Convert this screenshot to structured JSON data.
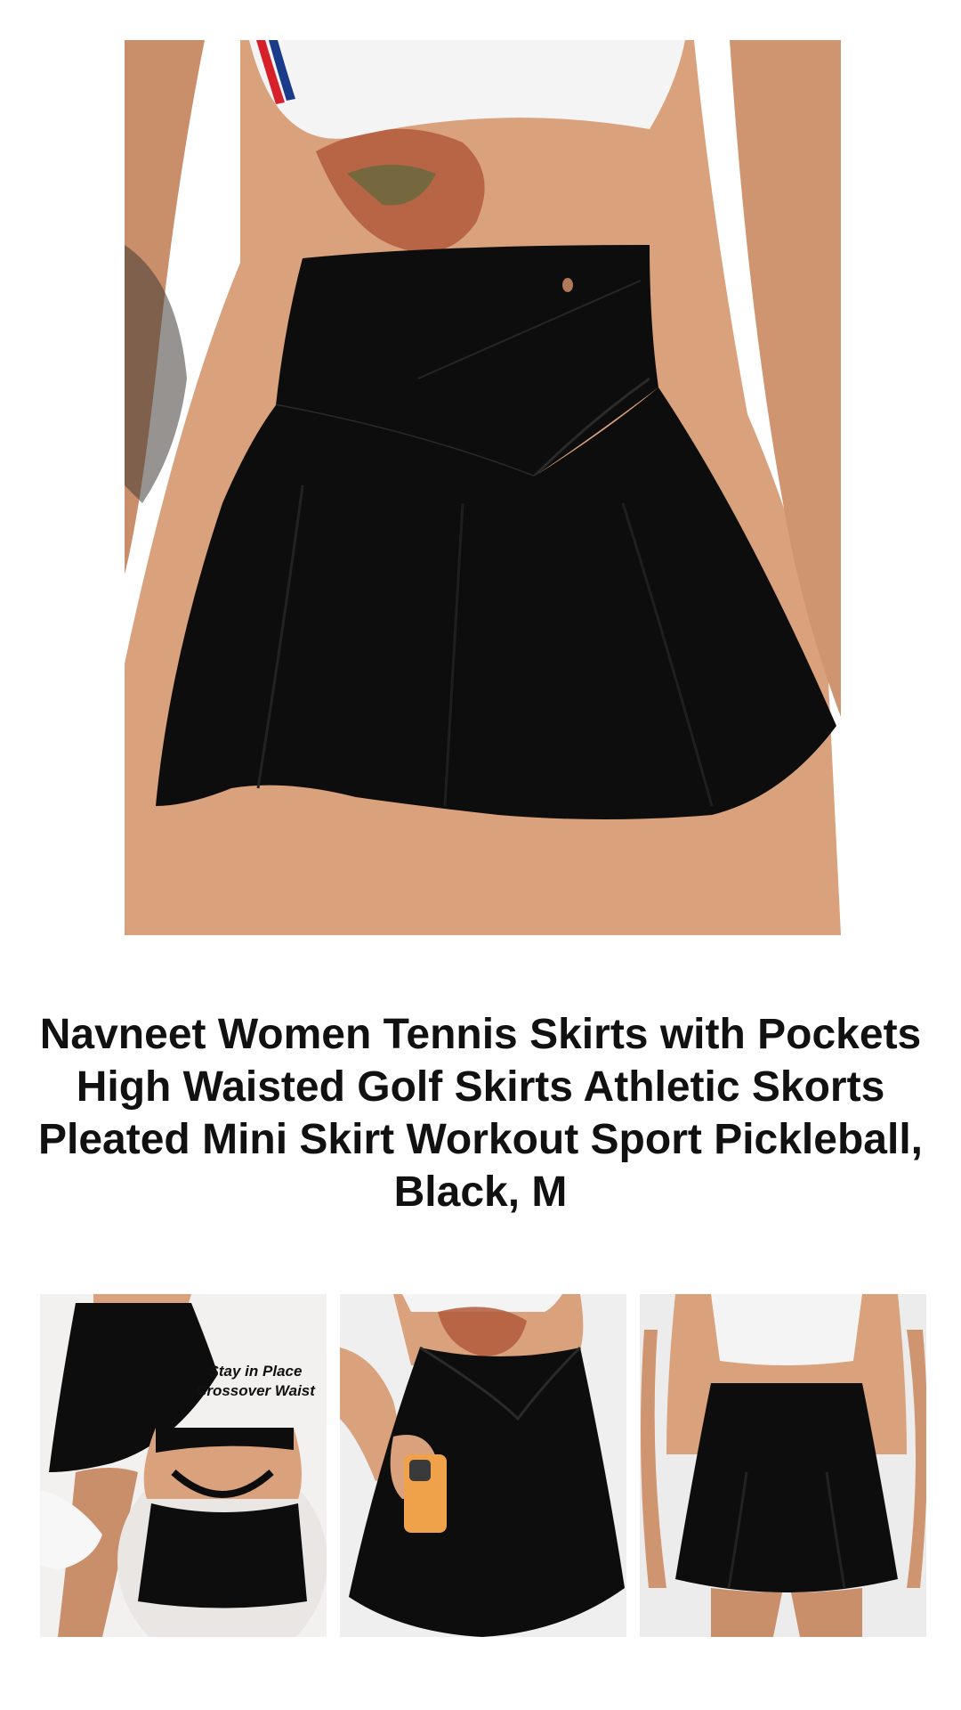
{
  "product": {
    "title": "Navneet Women Tennis Skirts with Pockets High Waisted Golf Skirts Athletic Skorts Pleated Mini Skirt Workout Sport Pickleball, Black, M",
    "hero_image_label": "black crossover waist tennis skirt front view",
    "colors": {
      "skirt": "#0d0d0d",
      "skin": "#d9a17c",
      "top": "#f4f4f4",
      "tattoo": "#b05a3c",
      "phone": "#f0a24a",
      "thumb_bg": "#ececec"
    }
  },
  "thumbnails": [
    {
      "label": "crossover waist detail",
      "callout_line1": "Stay in Place",
      "callout_line2": "Crossover Waist"
    },
    {
      "label": "side pocket with phone"
    },
    {
      "label": "back view"
    }
  ]
}
